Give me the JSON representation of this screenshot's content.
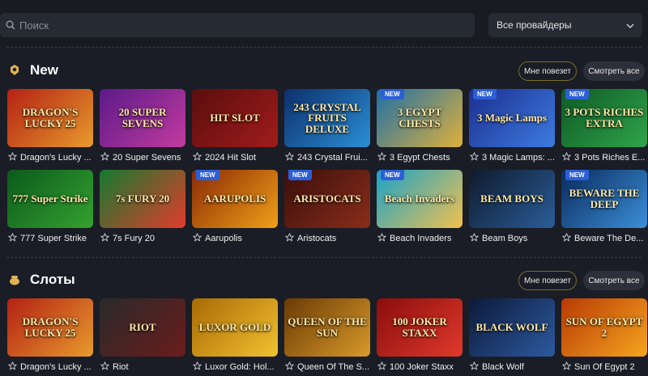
{
  "search": {
    "placeholder": "Поиск"
  },
  "provider_select": {
    "value": "Все провайдеры"
  },
  "sections": [
    {
      "title": "New",
      "icon": "sticker-icon",
      "lucky_label": "Мне повезет",
      "all_label": "Смотреть все",
      "rows": [
        [
          {
            "name": "Dragon's Lucky ...",
            "art": "DRAGON'S LUCKY 25",
            "colors": [
              "#b32014",
              "#e89b2c"
            ],
            "new": false
          },
          {
            "name": "20 Super Sevens",
            "art": "20 SUPER SEVENS",
            "colors": [
              "#5b1a8a",
              "#c23b9e"
            ],
            "new": false
          },
          {
            "name": "2024 Hit Slot",
            "art": "HIT SLOT",
            "colors": [
              "#5a0d0d",
              "#a11c1c"
            ],
            "new": false
          },
          {
            "name": "243 Crystal Frui...",
            "art": "243 CRYSTAL FRUITS DELUXE",
            "colors": [
              "#0d2f6b",
              "#2a8fd6"
            ],
            "new": false
          },
          {
            "name": "3 Egypt Chests",
            "art": "3 EGYPT CHESTS",
            "colors": [
              "#1d6fa8",
              "#e0b13a"
            ],
            "new": true
          },
          {
            "name": "3 Magic Lamps: ...",
            "art": "3 Magic Lamps",
            "colors": [
              "#1b2f8f",
              "#3d7be0"
            ],
            "new": true
          },
          {
            "name": "3 Pots Riches E...",
            "art": "3 POTS RICHES EXTRA",
            "colors": [
              "#0e5a24",
              "#2fa44b"
            ],
            "new": true
          }
        ],
        [
          {
            "name": "777 Super Strike",
            "art": "777 Super Strike",
            "colors": [
              "#0b5a1c",
              "#35a12f"
            ],
            "new": false
          },
          {
            "name": "7s Fury 20",
            "art": "7s FURY 20",
            "colors": [
              "#137a30",
              "#e23c2b"
            ],
            "new": false
          },
          {
            "name": "Aarupolis",
            "art": "AARUPOLIS",
            "colors": [
              "#8a2a05",
              "#f0a018"
            ],
            "new": true
          },
          {
            "name": "Aristocats",
            "art": "ARISTOCATS",
            "colors": [
              "#3a0f0c",
              "#8a2d1a"
            ],
            "new": true
          },
          {
            "name": "Beach Invaders",
            "art": "Beach Invaders",
            "colors": [
              "#1aa3c9",
              "#f2c14d"
            ],
            "new": true
          },
          {
            "name": "Beam Boys",
            "art": "BEAM BOYS",
            "colors": [
              "#0f1a2b",
              "#2a5d9a"
            ],
            "new": false
          },
          {
            "name": "Beware The De...",
            "art": "BEWARE THE DEEP",
            "colors": [
              "#0a2a5c",
              "#3b8fd8"
            ],
            "new": true
          }
        ]
      ]
    },
    {
      "title": "Слоты",
      "icon": "pot-icon",
      "lucky_label": "Мне повезет",
      "all_label": "Смотреть все",
      "rows": [
        [
          {
            "name": "Dragon's Lucky ...",
            "art": "DRAGON'S LUCKY 25",
            "colors": [
              "#b32014",
              "#e89b2c"
            ],
            "new": false
          },
          {
            "name": "Riot",
            "art": "RIOT",
            "colors": [
              "#2a2a2a",
              "#6b1c1c"
            ],
            "new": false
          },
          {
            "name": "Luxor Gold: Hol...",
            "art": "LUXOR GOLD",
            "colors": [
              "#a86a05",
              "#f2c230"
            ],
            "new": false
          },
          {
            "name": "Queen Of The S...",
            "art": "QUEEN OF THE SUN",
            "colors": [
              "#6b3a05",
              "#d89a2a"
            ],
            "new": false
          },
          {
            "name": "100 Joker Staxx",
            "art": "100 JOKER STAXX",
            "colors": [
              "#8a0d0d",
              "#e0392b"
            ],
            "new": false
          },
          {
            "name": "Black Wolf",
            "art": "BLACK WOLF",
            "colors": [
              "#0c1a3a",
              "#2d5aa0"
            ],
            "new": false
          },
          {
            "name": "Sun Of Egypt 2",
            "art": "SUN OF EGYPT 2",
            "colors": [
              "#b83a05",
              "#f5a51e"
            ],
            "new": false
          }
        ]
      ]
    }
  ]
}
